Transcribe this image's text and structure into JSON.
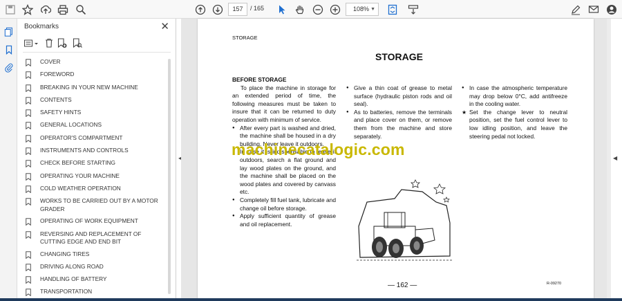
{
  "toolbar": {
    "page_current": "157",
    "page_separator": "/",
    "page_total": "165",
    "zoom": "108%",
    "icons": [
      "save-icon",
      "bookmark-star-icon",
      "upload-icon",
      "print-icon",
      "zoom-search-icon",
      "page-up-icon",
      "page-down-icon",
      "select-cursor-icon",
      "hand-tool-icon",
      "zoom-out-icon",
      "zoom-in-icon",
      "fit-page-icon",
      "scroll-mode-icon",
      "edit-sign-icon",
      "comment-icon",
      "account-icon"
    ]
  },
  "bookmarks": {
    "title": "Bookmarks",
    "close": "✕",
    "items": [
      "COVER",
      "FOREWORD",
      "BREAKING IN YOUR NEW MACHINE",
      "CONTENTS",
      "SAFETY HINTS",
      "GENERAL LOCATIONS",
      "OPERATOR'S COMPARTMENT",
      "INSTRUMENTS AND CONTROLS",
      "CHECK BEFORE STARTING",
      "OPERATING YOUR MACHINE",
      "COLD WEATHER OPERATION",
      "WORKS TO BE CARRIED OUT BY A MOTOR GRADER",
      "OPERATING OF WORK EQUIPMENT",
      "REVERSING AND REPLACEMENT OF CUTTING EDGE AND END BIT",
      "CHANGING TIRES",
      "DRIVING ALONG ROAD",
      "HANDLING OF BATTERY",
      "TRANSPORTATION"
    ]
  },
  "document": {
    "running_header": "STORAGE",
    "title": "STORAGE",
    "subheading": "BEFORE STORAGE",
    "intro": "To place the machine in storage for an extended period of time, the following measures must be taken to insure that it can be returned to duty operation with minimum of service.",
    "col1_bullets": [
      "After every part is washed and dried, the machine shall be housed in a dry building. Never leave it outdoors.",
      "In case it is indispensable to leave it outdoors, search a flat ground and lay wood plates on the ground, and the machine shall be placed on the wood plates and covered by canvass etc.",
      "Completely fill fuel tank, lubricate and change oil before storage.",
      "Apply sufficient quantity of grease and oil replacement."
    ],
    "col2_bullets": [
      "Give a thin coat of grease to metal surface (hydraulic piston rods and oil seal).",
      "As to batteries, remove the terminals and place cover on them, or remove them from the machine and store separately."
    ],
    "col3_bullets": [
      "In case the atmospheric temperature may drop below 0°C, add antifreeze in the cooling water."
    ],
    "col3_star": "Set the change lever to neutral position, set the fuel control lever to low idling position, and leave the steering pedal not locked.",
    "watermark": "machinecatalogic.com",
    "page_number": "— 162 —",
    "figure_code": "R-09270"
  }
}
